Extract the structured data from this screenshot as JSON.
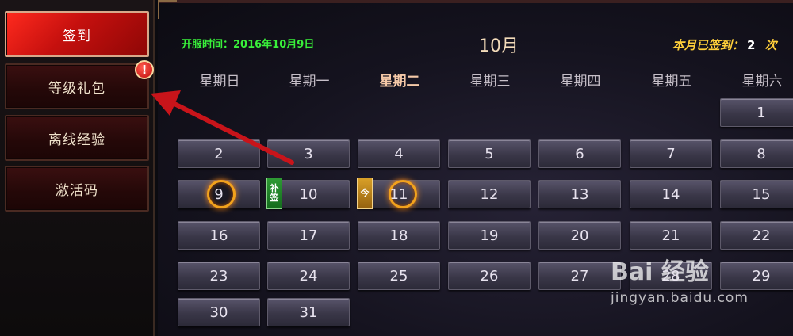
{
  "sidebar": {
    "items": [
      {
        "label": "签到",
        "active": true
      },
      {
        "label": "等级礼包",
        "active": false
      },
      {
        "label": "离线经验",
        "active": false
      },
      {
        "label": "激活码",
        "active": false
      }
    ],
    "badge": "!"
  },
  "calendar": {
    "open_date_text": "开服时间：2016年10月9日",
    "month_title": "10月",
    "signed_label": "本月已签到：",
    "signed_count": "2",
    "signed_extra": "次",
    "weekdays": [
      "星期日",
      "星期一",
      "星期二",
      "星期三",
      "星期四",
      "星期五",
      "星期六"
    ],
    "today_weekday_index": 2,
    "days": [
      "1",
      "2",
      "3",
      "4",
      "5",
      "6",
      "7",
      "8",
      "9",
      "10",
      "11",
      "12",
      "13",
      "14",
      "15",
      "16",
      "17",
      "18",
      "19",
      "20",
      "21",
      "22",
      "23",
      "24",
      "25",
      "26",
      "27",
      "28",
      "29",
      "30",
      "31"
    ],
    "first_day_weekday": 6,
    "signed_days": [
      "9",
      "11"
    ],
    "makeup_tag": {
      "day": "10",
      "text": "补签"
    },
    "today_tag": {
      "day": "11",
      "text": "今"
    }
  },
  "watermark": {
    "logo": "Bai 经验",
    "site": "jingyan.baidu.com"
  },
  "colors": {
    "active_red": "#c5100e",
    "open_date_green": "#39f03a",
    "signed_gold": "#ffcf3a",
    "arrow_red": "#c8141a"
  }
}
